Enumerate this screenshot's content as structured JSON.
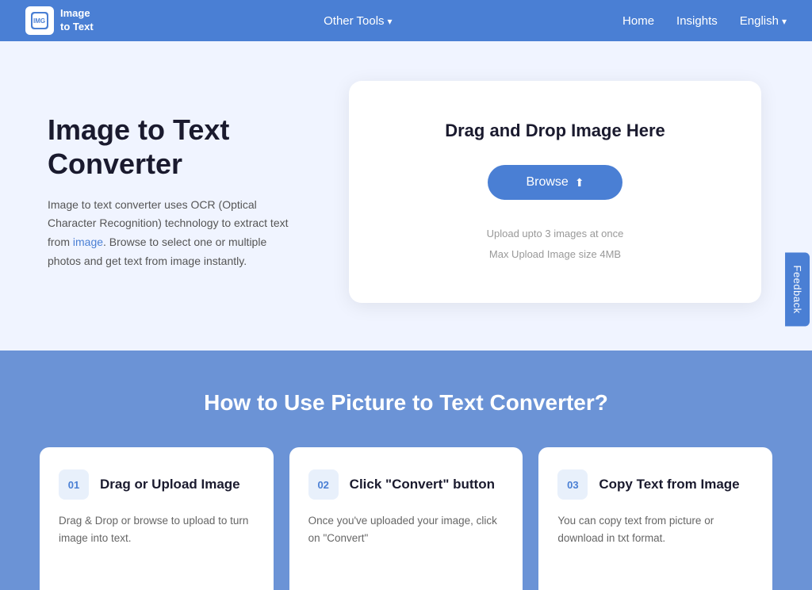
{
  "nav": {
    "logo_text": "Image\nto Text",
    "other_tools_label": "Other Tools",
    "home_label": "Home",
    "insights_label": "Insights",
    "language_label": "English"
  },
  "hero": {
    "title": "Image to Text Converter",
    "description_parts": [
      "Image to text converter uses OCR (Optical Character Recognition) technology to extract text from ",
      "image",
      ". Browse to select one or multiple photos and get text from image instantly."
    ],
    "upload_title": "Drag and Drop Image Here",
    "browse_label": "Browse",
    "upload_info_line1": "Upload upto 3 images at once",
    "upload_info_line2": "Max Upload Image size 4MB"
  },
  "feedback": {
    "label": "Feedback"
  },
  "how_to": {
    "title": "How to Use Picture to Text Converter?",
    "steps": [
      {
        "num": "01",
        "title": "Drag or Upload Image",
        "description": "Drag & Drop or browse to upload to turn image into text."
      },
      {
        "num": "02",
        "title": "Click \"Convert\" button",
        "description": "Once you've uploaded your image, click on \"Convert\""
      },
      {
        "num": "03",
        "title": "Copy Text from Image",
        "description": "You can copy text from picture or download in txt format."
      }
    ]
  }
}
